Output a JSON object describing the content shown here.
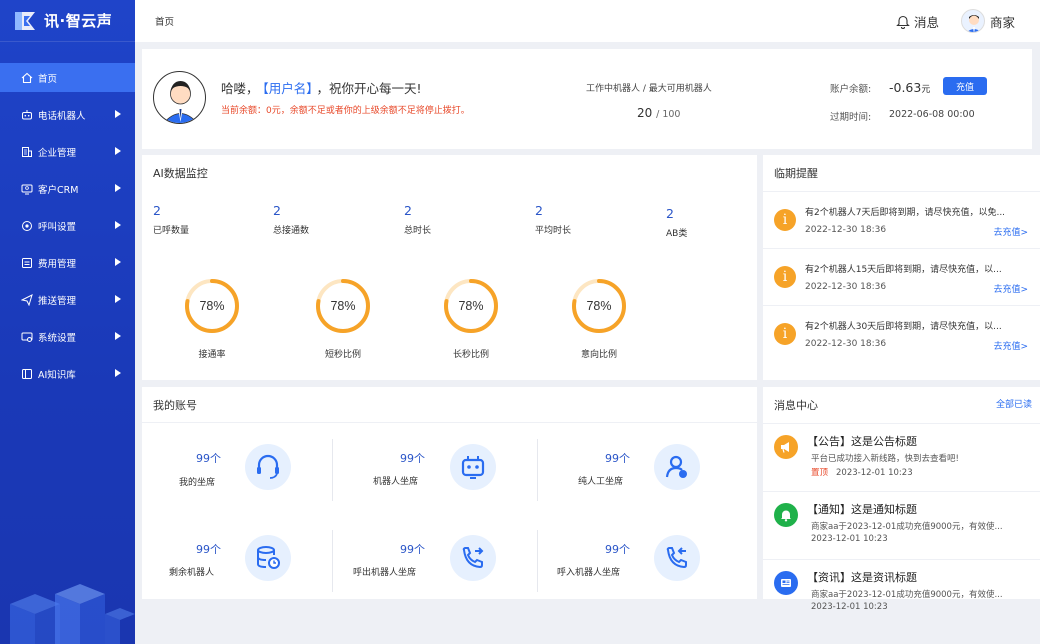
{
  "app": {
    "logo_text": "讯·智云声"
  },
  "sidebar": {
    "items": [
      {
        "label": "首页",
        "icon": "home-icon",
        "active": true
      },
      {
        "label": "电话机器人",
        "icon": "robot-icon"
      },
      {
        "label": "企业管理",
        "icon": "building-icon"
      },
      {
        "label": "客户CRM",
        "icon": "crm-icon"
      },
      {
        "label": "呼叫设置",
        "icon": "call-settings-icon"
      },
      {
        "label": "费用管理",
        "icon": "billing-icon"
      },
      {
        "label": "推送管理",
        "icon": "send-icon"
      },
      {
        "label": "系统设置",
        "icon": "system-settings-icon"
      },
      {
        "label": "AI知识库",
        "icon": "knowledge-icon"
      }
    ]
  },
  "header": {
    "breadcrumb": "首页",
    "messages_label": "消息",
    "user_name": "商家"
  },
  "welcome": {
    "greeting_prefix": "哈喽，",
    "username": "【用户名】",
    "greeting_suffix": "，祝你开心每一天!",
    "warning": "当前余额：0元，余额不足或者你的上级余额不足将停止拨打。",
    "robots_title": "工作中机器人 / 最大可用机器人",
    "robots_working": "20",
    "robots_max": "/ 100",
    "balance_label": "账户余额:",
    "balance_value": "-0.63",
    "balance_unit": "元",
    "recharge_label": "充值",
    "expiry_label": "过期时间:",
    "expiry_value": "2022-06-08 00:00"
  },
  "monitor": {
    "title": "AI数据监控",
    "stats": [
      {
        "value": "2",
        "label": "已呼数量"
      },
      {
        "value": "2",
        "label": "总接通数"
      },
      {
        "value": "2",
        "label": "总时长"
      },
      {
        "value": "2",
        "label": "平均时长"
      },
      {
        "value": "2",
        "label": "AB类"
      }
    ],
    "rings": [
      {
        "percent": 78,
        "text": "78%",
        "label": "接通率"
      },
      {
        "percent": 78,
        "text": "78%",
        "label": "短秒比例"
      },
      {
        "percent": 78,
        "text": "78%",
        "label": "长秒比例"
      },
      {
        "percent": 78,
        "text": "78%",
        "label": "意向比例"
      }
    ],
    "ring_color": "#f6a328"
  },
  "expiry": {
    "title": "临期提醒",
    "items": [
      {
        "text": "有2个机器人7天后即将到期，请尽快充值，以免...",
        "date": "2022-12-30 18:36",
        "link": "去充值>"
      },
      {
        "text": "有2个机器人15天后即将到期，请尽快充值，以...",
        "date": "2022-12-30 18:36",
        "link": "去充值>"
      },
      {
        "text": "有2个机器人30天后即将到期，请尽快充值，以...",
        "date": "2022-12-30 18:36",
        "link": "去充值>"
      }
    ]
  },
  "account": {
    "title": "我的账号",
    "cells": [
      {
        "count": "99个",
        "label": "我的坐席",
        "icon": "headset-icon"
      },
      {
        "count": "99个",
        "label": "机器人坐席",
        "icon": "robot-face-icon"
      },
      {
        "count": "99个",
        "label": "纯人工坐席",
        "icon": "agent-person-icon"
      },
      {
        "count": "99个",
        "label": "剩余机器人",
        "icon": "database-clock-icon"
      },
      {
        "count": "99个",
        "label": "呼出机器人坐席",
        "icon": "phone-outgoing-icon"
      },
      {
        "count": "99个",
        "label": "呼入机器人坐席",
        "icon": "phone-incoming-icon"
      }
    ]
  },
  "message_center": {
    "title": "消息中心",
    "mark_all_read": "全部已读",
    "items": [
      {
        "title": "【公告】这是公告标题",
        "sub": "平台已成功接入新线路，快到去查看吧!",
        "pinned": "置顶",
        "date": "2023-12-01 10:23",
        "icon": "megaphone-icon",
        "color": "#f6a328"
      },
      {
        "title": "【通知】这是通知标题",
        "sub": "商家aa于2023-12-01成功充值9000元，有效使...",
        "pinned": "",
        "date": "2023-12-01 10:23",
        "icon": "bell-icon",
        "color": "#1fb14a"
      },
      {
        "title": "【资讯】这是资讯标题",
        "sub": "商家aa于2023-12-01成功充值9000元，有效使...",
        "pinned": "",
        "date": "2023-12-01 10:23",
        "icon": "news-icon",
        "color": "#2a6cf0"
      }
    ]
  }
}
